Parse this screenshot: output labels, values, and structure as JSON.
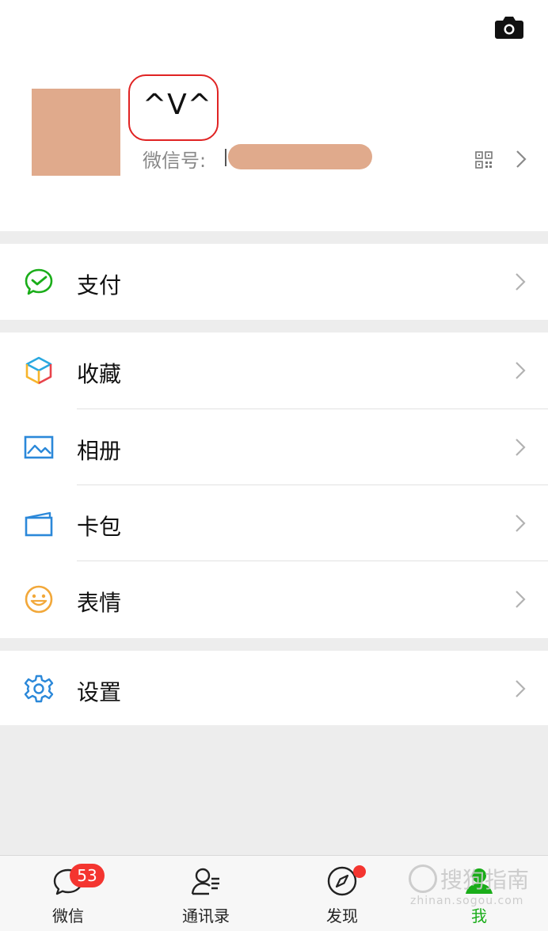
{
  "profile": {
    "nickname": "^V^",
    "wechat_id_label": "微信号:"
  },
  "menu": {
    "pay": "支付",
    "favorites": "收藏",
    "album": "相册",
    "cards": "卡包",
    "stickers": "表情",
    "settings": "设置"
  },
  "tabbar": {
    "chats": {
      "label": "微信",
      "badge": "53"
    },
    "contacts": {
      "label": "通讯录"
    },
    "discover": {
      "label": "发现"
    },
    "me": {
      "label": "我"
    }
  },
  "watermark": {
    "main": "搜狗指南",
    "sub": "zhinan.sogou.com"
  },
  "colors": {
    "accent_green": "#1aad19",
    "badge_red": "#f43530",
    "highlight_red": "#e02323",
    "redaction": "#e0aa8c"
  }
}
